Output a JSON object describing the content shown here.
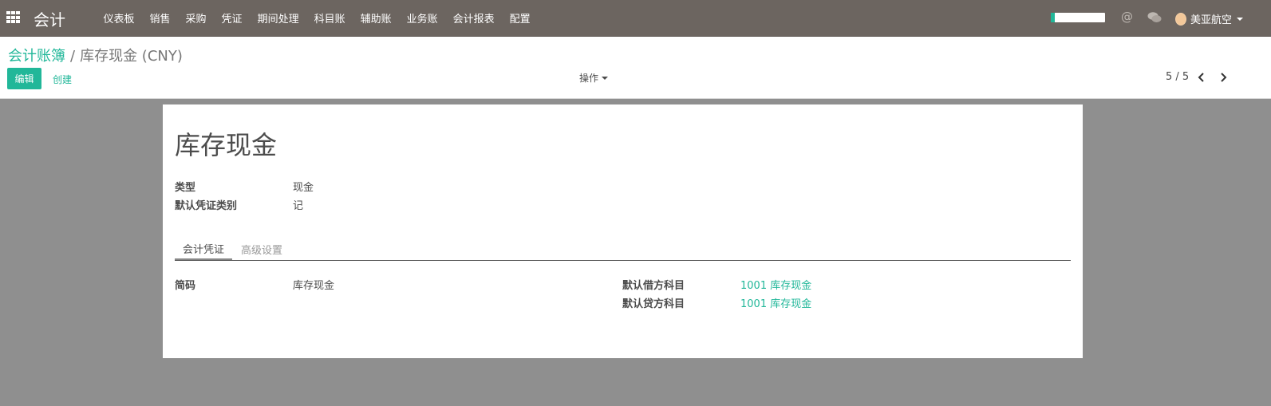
{
  "app": {
    "brand": "会计",
    "menu": [
      "仪表板",
      "销售",
      "采购",
      "凭证",
      "期间处理",
      "科目账",
      "辅助账",
      "业务账",
      "会计报表",
      "配置"
    ],
    "progress_fraction": 0.08,
    "user_name": "美亚航空",
    "accent_color": "#21b799",
    "navbar_color": "#6c6560"
  },
  "breadcrumb": {
    "parent": "会计账簿",
    "separator": "/",
    "current": "库存现金 (CNY)"
  },
  "toolbar": {
    "edit_label": "编辑",
    "create_label": "创建",
    "actions_label": "操作",
    "pager": "5 / 5"
  },
  "form": {
    "title": "库存现金",
    "fields": [
      {
        "label": "类型",
        "value": "现金"
      },
      {
        "label": "默认凭证类别",
        "value": "记"
      }
    ],
    "tabs": [
      {
        "label": "会计凭证",
        "active": true
      },
      {
        "label": "高级设置",
        "active": false
      }
    ],
    "tab_content": {
      "short_code_label": "简码",
      "short_code_value": "库存现金",
      "debit_label": "默认借方科目",
      "debit_value": "1001 库存现金",
      "credit_label": "默认贷方科目",
      "credit_value": "1001 库存现金"
    }
  }
}
